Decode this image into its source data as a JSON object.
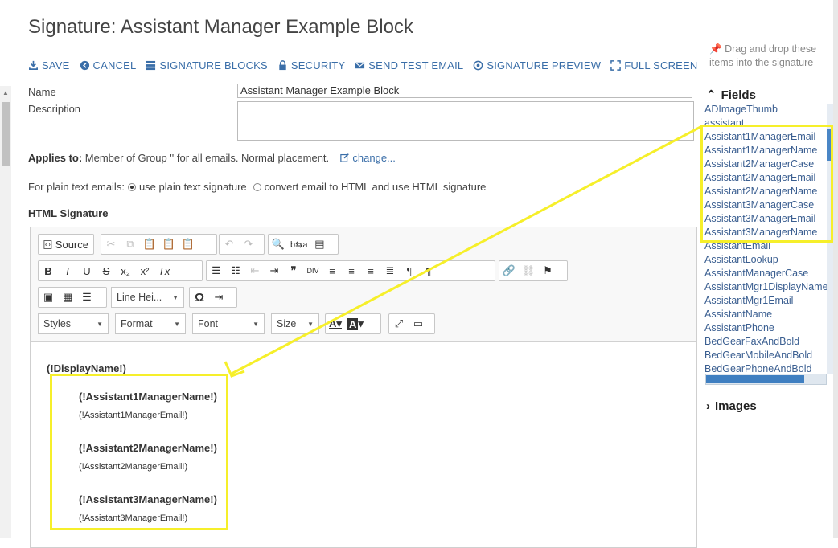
{
  "page": {
    "title": "Signature: Assistant Manager Example Block"
  },
  "toolbar": {
    "save": "SAVE",
    "cancel": "CANCEL",
    "signature_blocks": "SIGNATURE BLOCKS",
    "security": "SECURITY",
    "send_test_email": "SEND TEST EMAIL",
    "signature_preview": "SIGNATURE PREVIEW",
    "full_screen": "FULL SCREEN"
  },
  "form": {
    "name_label": "Name",
    "name_value": "Assistant Manager Example Block",
    "description_label": "Description",
    "description_value": "",
    "applies_label": "Applies to:",
    "applies_text": "Member of Group '' for all emails. Normal placement.",
    "change_link": "change...",
    "plain_text_label": "For plain text emails:",
    "plain_option1": "use plain text signature",
    "plain_option2": "convert email to HTML and use HTML signature",
    "html_signature_label": "HTML Signature"
  },
  "editor": {
    "source_label": "Source",
    "line_height": "Line Hei...",
    "styles": "Styles",
    "format": "Format",
    "font": "Font",
    "size": "Size",
    "content": {
      "display": "(!DisplayName!)",
      "blocks": [
        {
          "name": "(!Assistant1ManagerName!)",
          "email": "(!Assistant1ManagerEmail!)"
        },
        {
          "name": "(!Assistant2ManagerName!)",
          "email": "(!Assistant2ManagerEmail!)"
        },
        {
          "name": "(!Assistant3ManagerName!)",
          "email": "(!Assistant3ManagerEmail!)"
        }
      ]
    }
  },
  "right_panel": {
    "hint": "Drag and drop these items into the signature",
    "fields_header": "Fields",
    "images_header": "Images",
    "fields": [
      "ADImageThumb",
      "assistant",
      "Assistant1ManagerEmail",
      "Assistant1ManagerName",
      "Assistant2ManagerCase",
      "Assistant2ManagerEmail",
      "Assistant2ManagerName",
      "Assistant3ManagerCase",
      "Assistant3ManagerEmail",
      "Assistant3ManagerName",
      "AssistantEmail",
      "AssistantLookup",
      "AssistantManagerCase",
      "AssistantMgr1DisplayName",
      "AssistantMgr1Email",
      "AssistantName",
      "AssistantPhone",
      "BedGearFaxAndBold",
      "BedGearMobileAndBold",
      "BedGearPhoneAndBold"
    ]
  },
  "colors": {
    "link": "#3a6ea8",
    "highlight": "#f6ef2a",
    "scroll_thumb": "#3f7fc1"
  }
}
